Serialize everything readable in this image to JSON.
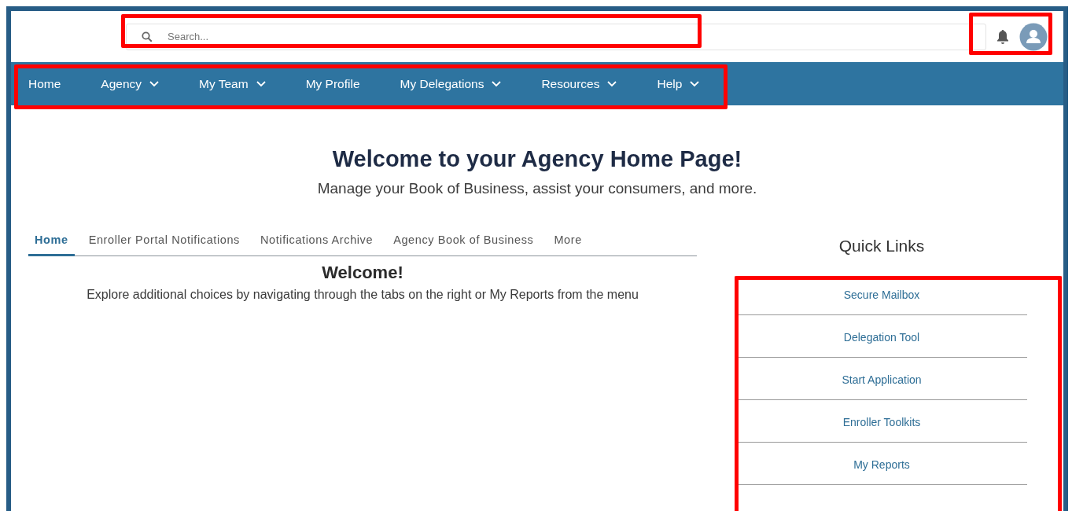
{
  "search": {
    "placeholder": "Search..."
  },
  "nav": [
    {
      "label": "Home",
      "dropdown": false
    },
    {
      "label": "Agency",
      "dropdown": true
    },
    {
      "label": "My Team",
      "dropdown": true
    },
    {
      "label": "My Profile",
      "dropdown": false
    },
    {
      "label": "My Delegations",
      "dropdown": true
    },
    {
      "label": "Resources",
      "dropdown": true
    },
    {
      "label": "Help",
      "dropdown": true
    }
  ],
  "hero": {
    "title": "Welcome to your Agency Home Page!",
    "subtitle": "Manage your Book of Business, assist your consumers, and more."
  },
  "tabs": [
    {
      "label": "Home",
      "selected": true
    },
    {
      "label": "Enroller Portal Notifications",
      "selected": false
    },
    {
      "label": "Notifications Archive",
      "selected": false
    },
    {
      "label": "Agency Book of Business",
      "selected": false
    },
    {
      "label": "More",
      "selected": false
    }
  ],
  "tab_content": {
    "title": "Welcome!",
    "text": "Explore additional choices by navigating through the tabs on the right or My Reports from the menu"
  },
  "quick_links": {
    "title": "Quick Links",
    "links": [
      "Secure Mailbox",
      "Delegation Tool",
      "Start Application",
      "Enroller Toolkits",
      "My Reports"
    ]
  }
}
